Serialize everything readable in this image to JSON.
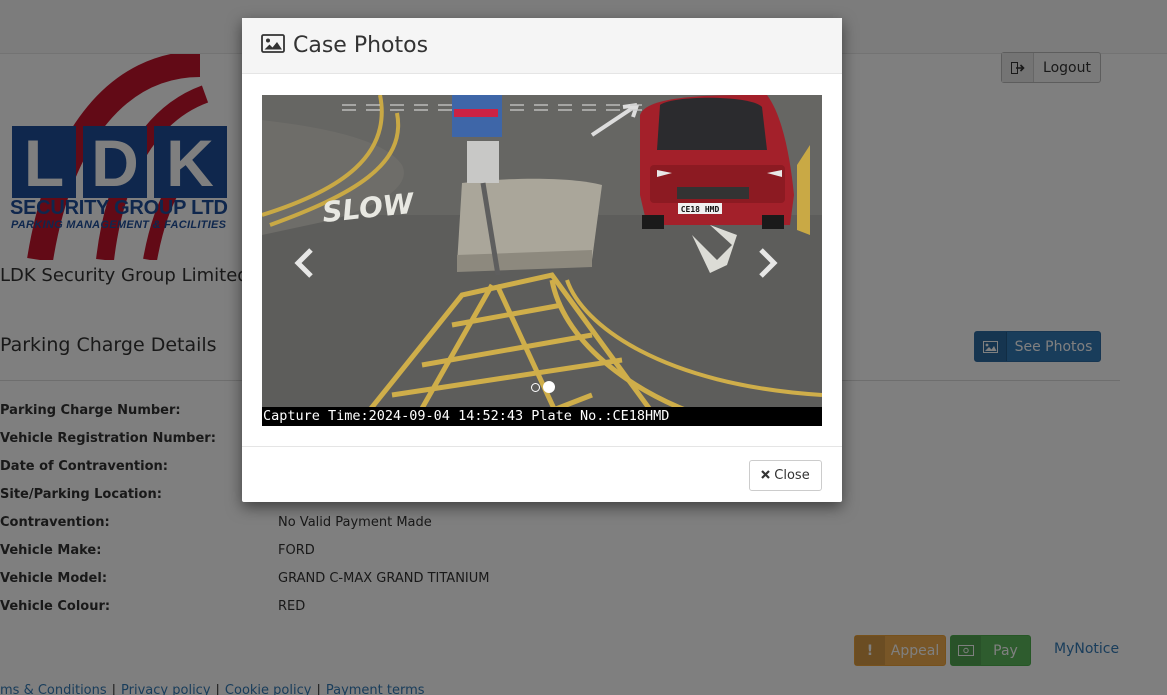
{
  "header": {
    "logout_label": "Logout"
  },
  "logo": {
    "letters": [
      "L",
      "D",
      "K"
    ],
    "line1": "SECURITY GROUP LTD",
    "line2": "PARKING MANAGEMENT & FACILITIES",
    "colors": {
      "red": "#c4152c",
      "blue": "#1f4f9a"
    }
  },
  "company_name": "LDK Security Group Limited PE",
  "section_title": "Parking Charge Details",
  "see_photos_label": "See Photos",
  "details": [
    {
      "label": "Parking Charge Number:",
      "value": ""
    },
    {
      "label": "Vehicle Registration Number:",
      "value": ""
    },
    {
      "label": "Date of Contravention:",
      "value": ""
    },
    {
      "label": "Site/Parking Location:",
      "value": ""
    },
    {
      "label": "Contravention:",
      "value": "No Valid Payment Made"
    },
    {
      "label": "Vehicle Make:",
      "value": "FORD"
    },
    {
      "label": "Vehicle Model:",
      "value": "GRAND C-MAX GRAND TITANIUM"
    },
    {
      "label": "Vehicle Colour:",
      "value": "RED"
    }
  ],
  "actions": {
    "appeal_label": "Appeal",
    "pay_label": "Pay",
    "mynotice_label": "MyNotice"
  },
  "footer_links": [
    "ms & Conditions",
    "Privacy policy",
    "Cookie policy",
    "Payment terms"
  ],
  "modal": {
    "title": "Case Photos",
    "road_text": "SLOW",
    "plate": "CE18 HMD",
    "caption": "Capture Time:2024-09-04 14:52:43 Plate No.:CE18HMD",
    "slide_count": 2,
    "active_slide": 2,
    "close_label": "Close"
  },
  "colors": {
    "primary": "#337ab7",
    "warning": "#f0ad4e",
    "success": "#5cb85c",
    "car_red": "#a3202a"
  }
}
